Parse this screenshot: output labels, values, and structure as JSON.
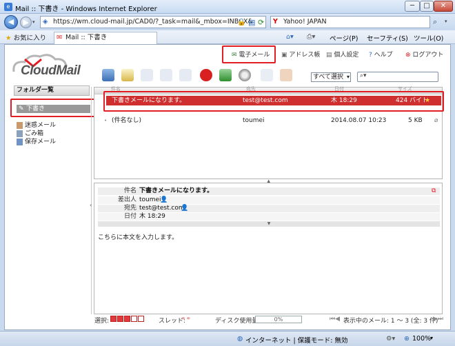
{
  "window": {
    "title": "Mail :: 下書き - Windows Internet Explorer",
    "buttons": {
      "minimize": "─",
      "maximize": "□",
      "close": "✕"
    }
  },
  "address_bar": {
    "url": "https://wm.cloud-mail.jp/CAD0/?_task=mail&_mbox=INBOX&",
    "search_provider": "Yahoo! JAPAN",
    "search_value": ""
  },
  "favorites_bar": {
    "favorites_label": "お気に入り",
    "tab_title": "Mail :: 下書き",
    "commands": [
      "ページ(P)",
      "セーフティ(S)",
      "ツール(O)"
    ]
  },
  "app": {
    "logo": "CloudMail",
    "top_nav": [
      "電子メール",
      "アドレス帳",
      "個人設定",
      "ヘルプ",
      "ログアウト"
    ],
    "select_all": "すべて選択",
    "search_placeholder": ""
  },
  "folders": {
    "header": "フォルダ一覧",
    "items": [
      "下書き",
      "迷惑メール",
      "ごみ箱",
      "保存メール"
    ]
  },
  "messages": {
    "header_partial": [
      "件名",
      "宛先",
      "日付",
      "サイズ"
    ],
    "rows": [
      {
        "subject": "下書きメールになります。",
        "to": "test@test.com",
        "date": "木 18:29",
        "size": "424 バイト",
        "flag": "★",
        "selected": true
      },
      {
        "subject": "(件名なし)",
        "to": "toumei",
        "date": "2014.08.07 10:23",
        "size": "5 KB",
        "flag": "📎",
        "selected": false
      }
    ]
  },
  "preview": {
    "fields": [
      {
        "label": "件名",
        "value": "下書きメールになります。"
      },
      {
        "label": "差出人",
        "value": "toumei"
      },
      {
        "label": "宛先",
        "value": "test@test.com"
      },
      {
        "label": "日付",
        "value": "木 18:29"
      }
    ],
    "body": "こちらに本文を入力します。"
  },
  "footer": {
    "select_label": "選択:",
    "thread_label": "スレッド:",
    "disk_label": "ディスク使用量:",
    "disk_value": "0%",
    "pager_text": "表示中のメール: 1 ～ 3 (全: 3 件)"
  },
  "status_bar": {
    "zone": "インターネット | 保護モード: 無効",
    "zoom": "100%"
  },
  "colors": {
    "accent_red": "#e31b23",
    "selected_row": "#cf2f2f"
  }
}
